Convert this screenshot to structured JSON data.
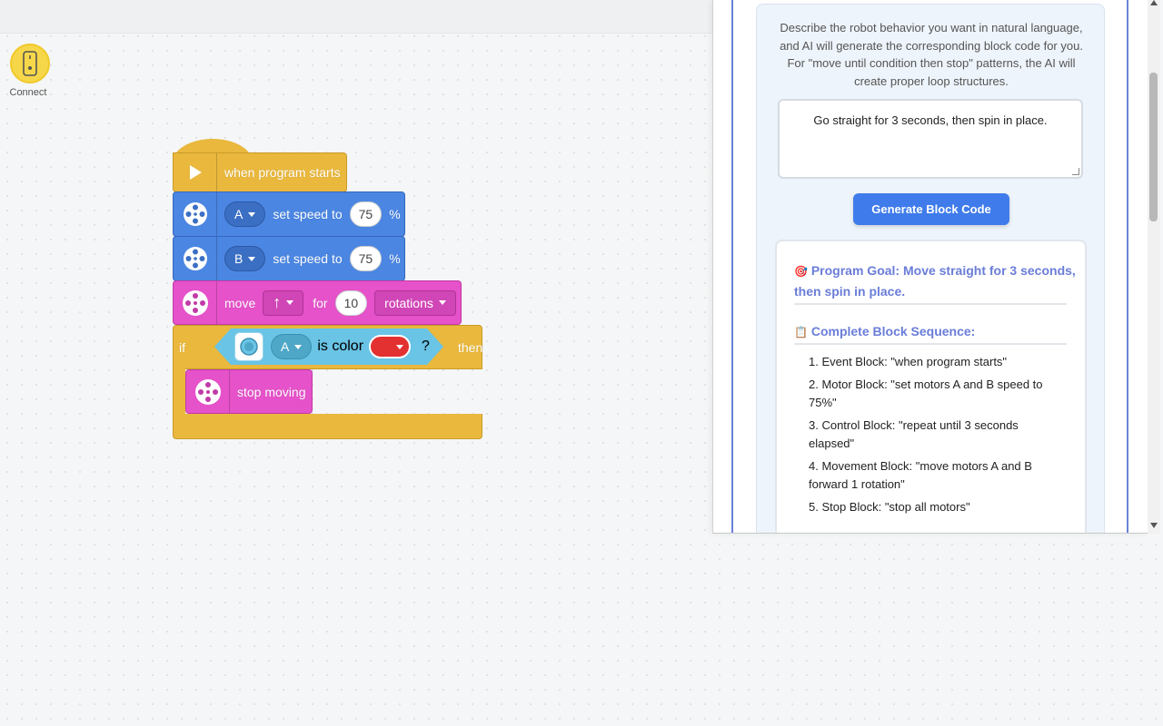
{
  "toolbar": {
    "connect_label": "Connect"
  },
  "blocks": {
    "event": {
      "label": "when program starts"
    },
    "motor_a": {
      "port": "A",
      "text": "set speed to",
      "value": "75",
      "unit": "%"
    },
    "motor_b": {
      "port": "B",
      "text": "set speed to",
      "value": "75",
      "unit": "%"
    },
    "move": {
      "text": "move",
      "direction": "↑",
      "for_text": "for",
      "value": "10",
      "unit": "rotations"
    },
    "if_block": {
      "if_text": "if",
      "port": "A",
      "is_color_text": "is color",
      "question": "?",
      "then_text": "then",
      "color": "#e33030"
    },
    "stop": {
      "label": "stop moving"
    }
  },
  "ai_panel": {
    "description": "Describe the robot behavior you want in natural language, and AI will generate the corresponding block code for you. For \"move until condition then stop\" patterns, the AI will create proper loop structures.",
    "prompt_value": "Go straight for 3 seconds, then spin in place.",
    "generate_button": "Generate Block Code",
    "result": {
      "goal_icon": "🎯",
      "goal": "Program Goal: Move straight for 3 seconds, then spin in place.",
      "sequence_icon": "📋",
      "sequence_title": "Complete Block Sequence:",
      "steps": [
        "1. Event Block: \"when program starts\"",
        "2. Motor Block: \"set motors A and B speed to 75%\"",
        "3. Control Block: \"repeat until 3 seconds elapsed\"",
        "4. Movement Block: \"move motors A and B forward 1 rotation\"",
        "5. Stop Block: \"stop all motors\""
      ]
    }
  }
}
